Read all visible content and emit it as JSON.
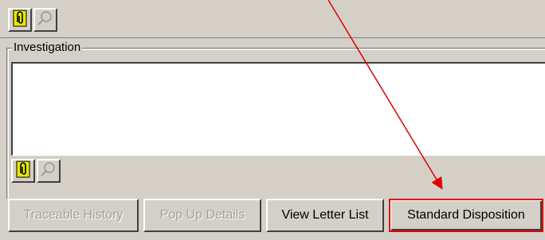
{
  "investigation_section": {
    "legend": "Investigation",
    "text_value": ""
  },
  "toolbar_top": {
    "items": [
      {
        "icon": "paperclip-icon"
      },
      {
        "icon": "magnifier-icon"
      }
    ]
  },
  "toolbar_bottom": {
    "items": [
      {
        "icon": "paperclip-icon"
      },
      {
        "icon": "magnifier-icon"
      }
    ]
  },
  "buttons": [
    {
      "label": "Traceable History",
      "enabled": false
    },
    {
      "label": "Pop Up Details",
      "enabled": false
    },
    {
      "label": "View Letter List",
      "enabled": true
    },
    {
      "label": "Standard Disposition",
      "enabled": true,
      "highlighted": true
    }
  ],
  "annotation": {
    "arrow_color": "#e00000",
    "highlight_color": "#e00000"
  },
  "colors": {
    "window_background": "#d4d0c8",
    "textbox_background": "#ffffff",
    "disabled_text": "#a0a0a0"
  }
}
